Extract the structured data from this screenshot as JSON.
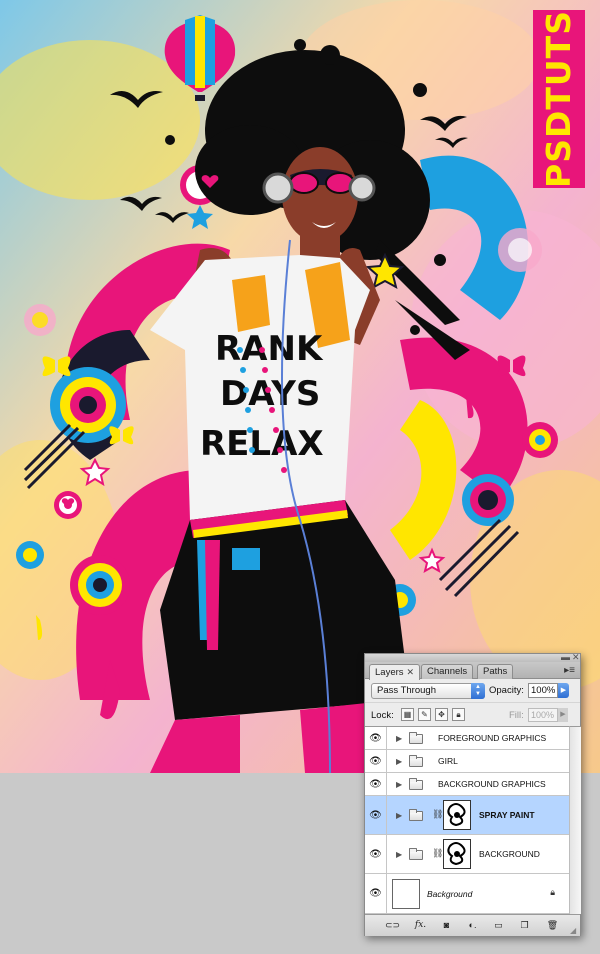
{
  "artwork": {
    "brand_text": "PSDTUTS",
    "shirt_text": [
      "RANK",
      "DAYS",
      "RELAX"
    ]
  },
  "layers_panel": {
    "tabs": [
      {
        "label": "Layers",
        "active": true,
        "close": "✕"
      },
      {
        "label": "Channels",
        "active": false
      },
      {
        "label": "Paths",
        "active": false
      }
    ],
    "blend_mode": "Pass Through",
    "opacity_label": "Opacity:",
    "opacity_value": "100%",
    "lock_label": "Lock:",
    "fill_label": "Fill:",
    "fill_value": "100%",
    "layers": [
      {
        "name": "FOREGROUND GRAPHICS",
        "type": "group",
        "visible": true,
        "selected": false
      },
      {
        "name": "GIRL",
        "type": "group",
        "visible": true,
        "selected": false
      },
      {
        "name": "BACKGROUND GRAPHICS",
        "type": "group",
        "visible": true,
        "selected": false
      },
      {
        "name": "SPRAY PAINT",
        "type": "group-with-mask",
        "visible": true,
        "selected": true
      },
      {
        "name": "BACKGROUND",
        "type": "group-with-mask",
        "visible": true,
        "selected": false
      },
      {
        "name": "Background",
        "type": "locked-layer",
        "visible": true,
        "selected": false
      }
    ],
    "bottom_icons": [
      "link-icon",
      "fx-icon",
      "layer-mask-icon",
      "adjustment-layer-icon",
      "new-group-icon",
      "new-layer-icon",
      "trash-icon"
    ],
    "colors": {
      "selected_row": "#b5d5ff",
      "accent_blue": "#2f6fd3"
    }
  }
}
